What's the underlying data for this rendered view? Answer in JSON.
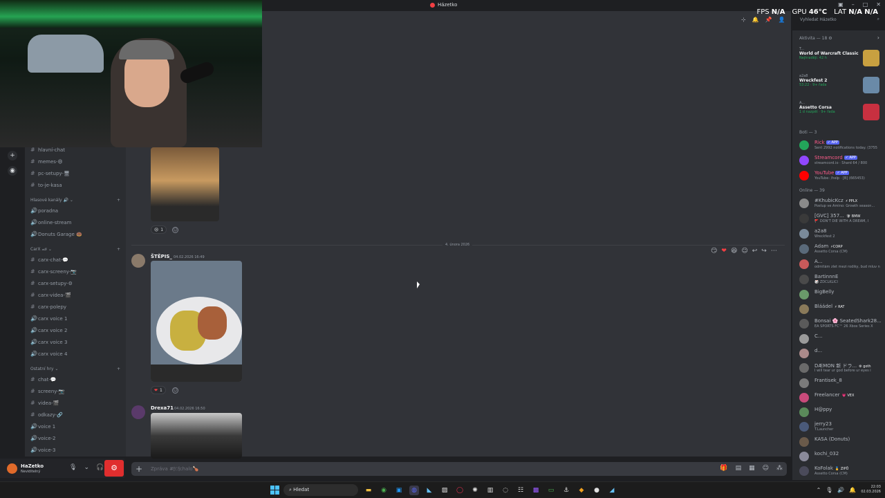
{
  "app": {
    "title": "Házetko"
  },
  "overlay": {
    "fps_label": "FPS",
    "fps_value": "N/A",
    "gpu_label": "GPU",
    "gpu_value": "46°C",
    "lat_label": "LAT",
    "lat_value1": "N/A",
    "lat_value2": "N/A"
  },
  "search": {
    "placeholder": "Vyhledat Házetko"
  },
  "channels": {
    "top": [
      {
        "icon": "#",
        "name": "hlavní-chat"
      },
      {
        "icon": "#",
        "name": "memes-😄"
      },
      {
        "icon": "#",
        "name": "pc-setupy-🖥"
      },
      {
        "icon": "#",
        "name": "to-je-kasa"
      }
    ],
    "voice_category": "Hlasové kanály 🔊 ⌄",
    "voice": [
      {
        "icon": "🔊",
        "name": "poradna"
      },
      {
        "icon": "🔊",
        "name": "online-stream"
      },
      {
        "icon": "🔊",
        "name": "Donuts Garage 🍩"
      }
    ],
    "carx_category": "CarX 🏎 ⌄",
    "carx": [
      {
        "icon": "#",
        "name": "carx-chat-💬"
      },
      {
        "icon": "#",
        "name": "carx-screeny-📷"
      },
      {
        "icon": "#",
        "name": "carx-setupy-⚙"
      },
      {
        "icon": "#",
        "name": "carx-videa-🎬"
      },
      {
        "icon": "#",
        "name": "carx-polepy"
      },
      {
        "icon": "🔊",
        "name": "carx voice 1"
      },
      {
        "icon": "🔊",
        "name": "carx voice 2"
      },
      {
        "icon": "🔊",
        "name": "carx voice 3"
      },
      {
        "icon": "🔊",
        "name": "carx voice 4"
      }
    ],
    "other_category": "Ostatní hry ⌄",
    "other": [
      {
        "icon": "#",
        "name": "chat-💬"
      },
      {
        "icon": "#",
        "name": "screeny-📷"
      },
      {
        "icon": "#",
        "name": "videa-🎬"
      },
      {
        "icon": "#",
        "name": "odkazy-🔗"
      },
      {
        "icon": "🔊",
        "name": "voice 1"
      },
      {
        "icon": "🔊",
        "name": "voice-2"
      },
      {
        "icon": "🔊",
        "name": "voice-3"
      }
    ]
  },
  "user": {
    "name": "HaZetko",
    "status": "Neviditelný"
  },
  "chat": {
    "date_divider": "4. února 2026",
    "reaction1": {
      "emoji": "😢",
      "count": "1"
    },
    "msg1": {
      "author": "ŠTĚPIS_",
      "time": "04.02.2026 16:49"
    },
    "reaction2": {
      "emoji": "❤",
      "count": "1"
    },
    "msg2": {
      "author": "Drexa71",
      "time": "04.02.2026 16:50"
    },
    "composer_placeholder": "Zpráva #🍽chalo🍗"
  },
  "members": {
    "activity_head": "Aktivita — 18 ⚙",
    "activities": [
      {
        "user": "T...",
        "title": "World of Warcraft Classic",
        "meta": "Nejhraději: 42 h",
        "thumb_color": "#c8a040"
      },
      {
        "user": "a2a8",
        "title": "Wreckfest 2",
        "meta": "53:22 · 9+ řada",
        "thumb_color": "#6a8aa8"
      },
      {
        "user": "A...",
        "title": "Assetto Corsa",
        "meta": "1 d nazpět · 9+ řada",
        "thumb_color": "#c83040"
      }
    ],
    "bots_head": "Boti — 3",
    "bots": [
      {
        "name": "Rick",
        "tag": "✓ APP",
        "sub": "Sent 2992 notifications today. (3755",
        "color": "#23a55a",
        "name_color": "#ff5c8a"
      },
      {
        "name": "Streamcord",
        "tag": "✓ APP",
        "sub": "streamcord.io · Shard 64 / 800",
        "color": "#9147ff",
        "name_color": "#ff5c8a"
      },
      {
        "name": "YouTube",
        "tag": "✓ APP",
        "sub": "YouTube: /help · [B] (665453)",
        "color": "#ff0000",
        "name_color": "#ff5c8a"
      }
    ],
    "online_head": "Online — 39",
    "online": [
      {
        "name": "#KhubicKcz",
        "tag": "⚡ PPLX",
        "sub": "Postup ve Amino: Growth season...",
        "color": "#8a8a8a"
      },
      {
        "name": "[GVC] 357...",
        "tag": "🛡 BMW",
        "sub": "🚩 DON'T DIE WITH A DREAM, I",
        "color": "#3a3a3a"
      },
      {
        "name": "a2a8",
        "tag": "",
        "sub": "Wreckfest 2",
        "color": "#7a8a9a"
      },
      {
        "name": "Adam",
        "tag": "⚡CORP",
        "sub": "Assetto Corsa (CM)",
        "color": "#5a6a7a"
      },
      {
        "name": "A...",
        "tag": "",
        "sub": "odmítám zlet mezi rodiky, bud mluv n",
        "color": "#c85a5a"
      },
      {
        "name": "BartinnnE",
        "tag": "",
        "sub": "🎲 ZDCLKLICI",
        "color": "#4a4a4a"
      },
      {
        "name": "BigBelly",
        "tag": "",
        "sub": "",
        "color": "#6a9a6a"
      },
      {
        "name": "Bláádel",
        "tag": "⚡ RAT",
        "sub": "",
        "color": "#8a7a5a"
      },
      {
        "name": "Bonsai 🌸 SeatedShark28...",
        "tag": "",
        "sub": "EA SPORTS FC™ 26 Xbox Series X",
        "color": "#5a5a5a"
      },
      {
        "name": "C...",
        "tag": "",
        "sub": "",
        "color": "#9a9a9a"
      },
      {
        "name": "d...",
        "tag": "",
        "sub": "",
        "color": "#aa8a8a"
      },
      {
        "name": "DÆMON 新 ドラ...",
        "tag": "⚙ goth",
        "sub": "I will tear ur god before ur eyes i",
        "color": "#6a6a6a"
      },
      {
        "name": "Frantisek_8",
        "tag": "",
        "sub": "",
        "color": "#7a7a7a"
      },
      {
        "name": "Freelancer",
        "tag": "💗 VEX",
        "sub": "",
        "color": "#c84a7a"
      },
      {
        "name": "H@ppy",
        "tag": "",
        "sub": "",
        "color": "#5a8a5a"
      },
      {
        "name": "jerry23",
        "tag": "",
        "sub": "T.Launcher",
        "color": "#4a5a7a"
      },
      {
        "name": "KASA (Donuts)",
        "tag": "",
        "sub": "",
        "color": "#6a5a4a"
      },
      {
        "name": "kochi_032",
        "tag": "",
        "sub": "",
        "color": "#8a8a9a"
      },
      {
        "name": "KoFolak",
        "tag": "🥇 ZIPŮ",
        "sub": "Assetto Corsa (CM)",
        "color": "#4a4a5a"
      }
    ]
  },
  "taskbar": {
    "search_label": "Hledat",
    "time": "22:03",
    "date": "02.03.2026"
  },
  "colors": {
    "accent": "#5865f2",
    "danger": "#e02e2e",
    "online": "#23a55a"
  }
}
